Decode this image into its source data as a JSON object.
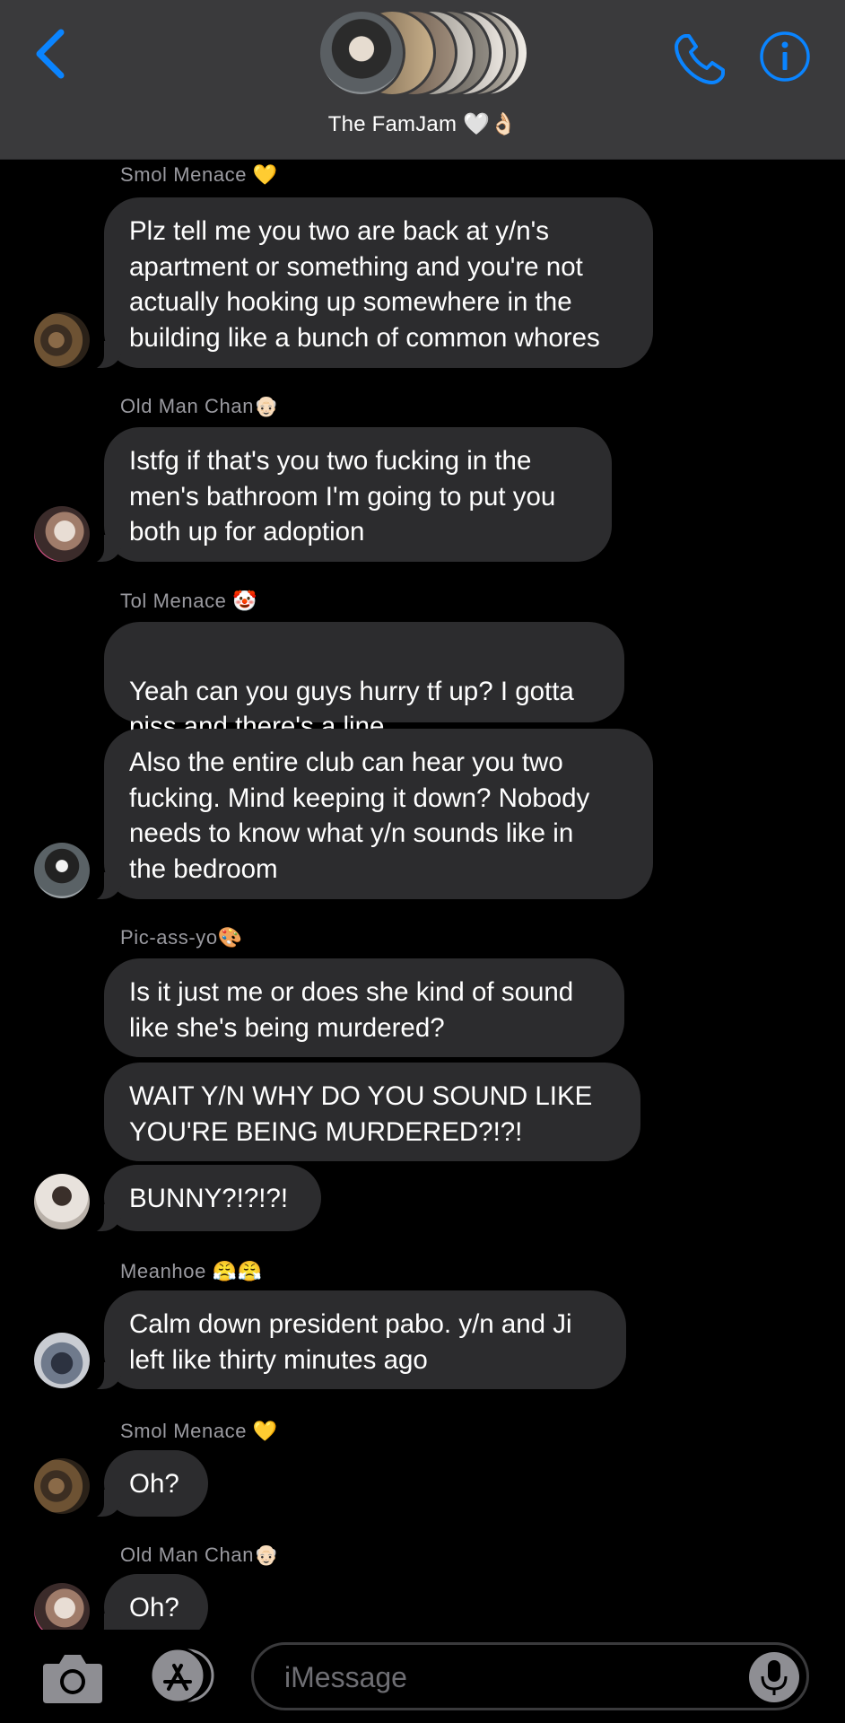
{
  "header": {
    "group_name": "The FamJam 🤍👌🏻"
  },
  "messages": [
    {
      "sender": "Smol Menace 💛",
      "bubbles": [
        "Plz tell me you two are back at y/n's\napartment or something and you're not\nactually hooking up somewhere in the\nbuilding like a bunch of common whores"
      ]
    },
    {
      "sender": "Old Man Chan👴🏻",
      "bubbles": [
        "Istfg if that's you two fucking in the\nmen's bathroom I'm going to put you\nboth up for adoption"
      ]
    },
    {
      "sender": "Tol Menace 🤡",
      "bubbles": [
        "Yeah can you guys hurry tf up? I gotta\npiss and there's a line",
        "Also the entire club can hear you two\nfucking. Mind keeping it down? Nobody\nneeds to know what y/n sounds like in\nthe bedroom"
      ]
    },
    {
      "sender": "Pic-ass-yo🎨",
      "bubbles": [
        "Is it just me or does she kind of sound\nlike she's being murdered?",
        "WAIT Y/N WHY DO YOU SOUND LIKE\nYOU'RE BEING MURDERED?!?!",
        "BUNNY?!?!?!"
      ]
    },
    {
      "sender": "Meanhoe 😤😤",
      "bubbles": [
        "Calm down president pabo. y/n and Ji\nleft like thirty minutes ago"
      ]
    },
    {
      "sender": "Smol Menace 💛",
      "bubbles": [
        "Oh?"
      ]
    },
    {
      "sender": "Old Man Chan👴🏻",
      "bubbles": [
        "Oh?"
      ]
    }
  ],
  "composer": {
    "placeholder": "iMessage"
  },
  "icons": {
    "back": "chevron-left-icon",
    "phone": "phone-icon",
    "info": "info-icon",
    "camera": "camera-icon",
    "apps": "app-store-icon",
    "mic": "microphone-icon",
    "neutral_emoji": "neutral-face-emoji"
  },
  "colors": {
    "accent": "#0a84ff",
    "header_bg": "#3a3a3c",
    "bubble_bg": "#2c2c2e",
    "sender_text": "#9a9aa0",
    "background": "#000000"
  }
}
